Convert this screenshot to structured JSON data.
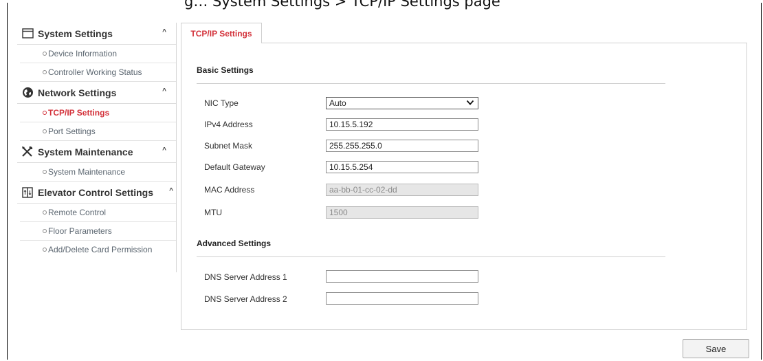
{
  "caption": "g… System Settings > TCP/IP Settings page",
  "sidebar": {
    "sections": [
      {
        "title": "System Settings",
        "icon": "window-icon",
        "items": [
          "Device Information",
          "Controller Working Status"
        ]
      },
      {
        "title": "Network Settings",
        "icon": "globe-icon",
        "items": [
          "TCP/IP Settings",
          "Port Settings"
        ]
      },
      {
        "title": "System Maintenance",
        "icon": "tools-icon",
        "items": [
          "System Maintenance"
        ]
      },
      {
        "title": "Elevator Control Settings",
        "icon": "elevator-icon",
        "items": [
          "Remote Control",
          "Floor Parameters",
          "Add/Delete Card Permission"
        ]
      }
    ],
    "active_item": "TCP/IP Settings"
  },
  "tab": {
    "label": "TCP/IP Settings"
  },
  "basic": {
    "title": "Basic Settings",
    "nic_type": {
      "label": "NIC Type",
      "value": "Auto"
    },
    "ipv4": {
      "label": "IPv4 Address",
      "value": "10.15.5.192"
    },
    "subnet": {
      "label": "Subnet Mask",
      "value": "255.255.255.0"
    },
    "gateway": {
      "label": "Default Gateway",
      "value": "10.15.5.254"
    },
    "mac": {
      "label": "MAC Address",
      "value": "aa-bb-01-cc-02-dd"
    },
    "mtu": {
      "label": "MTU",
      "value": "1500"
    }
  },
  "advanced": {
    "title": "Advanced Settings",
    "dns1": {
      "label": "DNS Server Address 1",
      "value": ""
    },
    "dns2": {
      "label": "DNS Server Address 2",
      "value": ""
    }
  },
  "save_label": "Save",
  "colors": {
    "accent": "#d3313a",
    "border": "#cfcfcf"
  }
}
